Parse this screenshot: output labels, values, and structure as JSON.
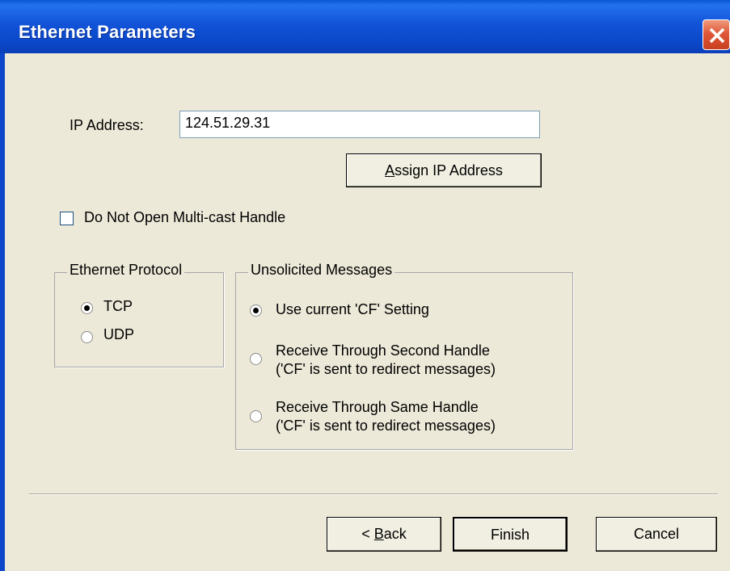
{
  "window": {
    "title": "Ethernet Parameters"
  },
  "ip": {
    "label": "IP Address:",
    "value": "124.51.29.31"
  },
  "assign_button": {
    "prefix": "",
    "accel": "A",
    "rest": "ssign IP Address"
  },
  "multicast": {
    "label": "Do Not Open Multi-cast Handle",
    "checked": false
  },
  "protocol": {
    "title": "Ethernet Protocol",
    "options": [
      {
        "label": "TCP",
        "selected": true
      },
      {
        "label": "UDP",
        "selected": false
      }
    ]
  },
  "unsolicited": {
    "title": "Unsolicited Messages",
    "options": [
      {
        "line1": "Use current 'CF' Setting",
        "line2": "",
        "selected": true
      },
      {
        "line1": "Receive Through Second Handle",
        "line2": "('CF' is sent to redirect messages)",
        "selected": false
      },
      {
        "line1": "Receive Through Same Handle",
        "line2": "('CF' is sent to redirect messages)",
        "selected": false
      }
    ]
  },
  "buttons": {
    "back_prefix": "< ",
    "back_accel": "B",
    "back_rest": "ack",
    "finish": "Finish",
    "cancel": "Cancel"
  },
  "colors": {
    "title_bar": "#0b47c8",
    "close_button": "#e0583a",
    "dialog_bg": "#ece9d8"
  }
}
